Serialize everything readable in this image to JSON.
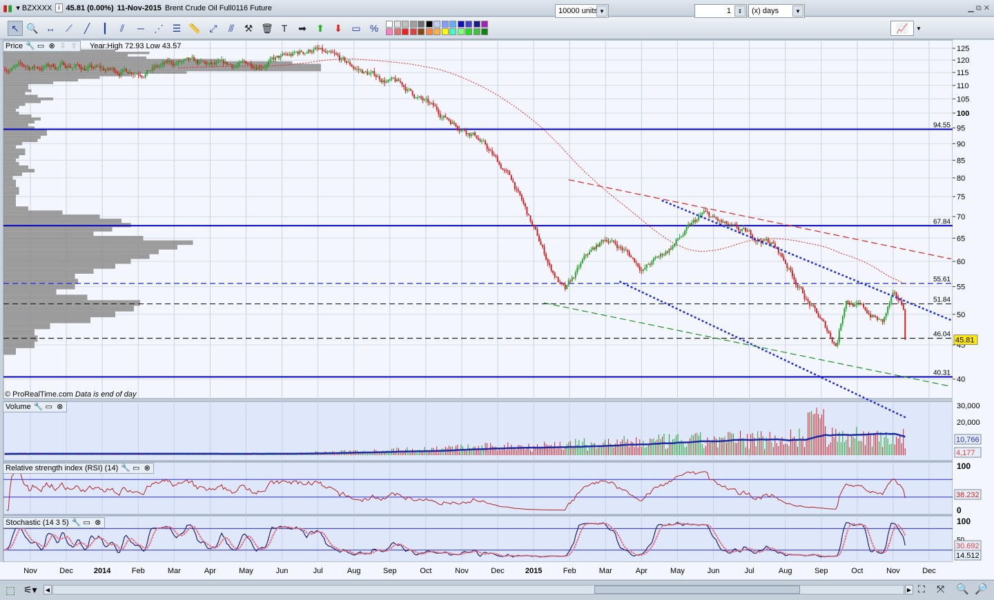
{
  "title": {
    "symbol": "BZXXXX",
    "price": "45.81 (0.00%)",
    "date": "11-Nov-2015",
    "name": "Brent Crude Oil Full0116 Future"
  },
  "toolbar": {
    "units": "10000 units",
    "period_value": "1",
    "period_unit": "(x) days",
    "tools": [
      "pointer-icon",
      "zoom-icon",
      "horizontal-measure-icon",
      "segment-icon",
      "line-icon",
      "vertical-line-icon",
      "channel-icon",
      "horizontal-line-icon",
      "fan-icon",
      "fibonacci-icon",
      "ruler-icon",
      "arrows-icon",
      "parallel-icon",
      "tools-icon",
      "trash-icon",
      "text-icon",
      "arrow-right-icon",
      "arrow-up-icon",
      "arrow-down-icon",
      "rectangle-icon",
      "percent-icon"
    ],
    "colors": [
      "#ffffff",
      "#e0e0e0",
      "#c0c0c0",
      "#a0a0a0",
      "#707070",
      "#000000",
      "#c0d0ff",
      "#80a0ff",
      "#60b0ff",
      "#1010c0",
      "#4040d0",
      "#1a1a90",
      "#a020c0",
      "#ff80c0",
      "#e07070",
      "#f02020",
      "#e04040",
      "#8b4513",
      "#ff8040",
      "#ffb040",
      "#ffff00",
      "#40ffc0",
      "#80ff80",
      "#20e020",
      "#40c040",
      "#108010"
    ]
  },
  "price_panel": {
    "label": "Price",
    "info": "Year:High 72.93 Low 43.57",
    "footer_brand": "© ProRealTime.com",
    "footer_note": "Data is end of day",
    "last": "45.81"
  },
  "volume_panel": {
    "label": "Volume",
    "avg": "10,766",
    "last": "4,177"
  },
  "rsi_panel": {
    "label": "Relative strength index (RSI) (14)",
    "value": "38.232"
  },
  "stoch_panel": {
    "label": "Stochastic (14 3 5)",
    "k": "30.692",
    "d": "14.512"
  },
  "colors": {
    "up": "#22a02a",
    "down": "#d02020",
    "level": "#0000c8",
    "ma": "#e02020",
    "volume_avg": "#1a2aa8"
  },
  "chart_data": {
    "type": "candlestick",
    "scale": "log",
    "ylim": [
      36,
      130
    ],
    "yticks": [
      125,
      120,
      115,
      110,
      105,
      100,
      95,
      90,
      85,
      80,
      75,
      70,
      65,
      60,
      55,
      50,
      45,
      40
    ],
    "xticks": [
      "Nov",
      "Dec",
      "2014",
      "Feb",
      "Mar",
      "Apr",
      "May",
      "Jun",
      "Jul",
      "Aug",
      "Sep",
      "Oct",
      "Nov",
      "Dec",
      "2015",
      "Feb",
      "Mar",
      "Apr",
      "May",
      "Jun",
      "Jul",
      "Aug",
      "Sep",
      "Oct",
      "Nov",
      "Dec"
    ],
    "anchors": [
      [
        "2013-11-01",
        117
      ],
      [
        "2013-12-01",
        118
      ],
      [
        "2014-01-01",
        115.7
      ],
      [
        "2014-02-01",
        116
      ],
      [
        "2014-03-01",
        119
      ],
      [
        "2014-04-01",
        117
      ],
      [
        "2014-05-01",
        118.5
      ],
      [
        "2014-06-01",
        121.5
      ],
      [
        "2014-06-20",
        125
      ],
      [
        "2014-07-01",
        121.5
      ],
      [
        "2014-08-01",
        115
      ],
      [
        "2014-09-01",
        110
      ],
      [
        "2014-10-01",
        100
      ],
      [
        "2014-11-01",
        93
      ],
      [
        "2014-12-01",
        79
      ],
      [
        "2015-01-01",
        59
      ],
      [
        "2015-01-14",
        54
      ],
      [
        "2015-02-01",
        61
      ],
      [
        "2015-02-16",
        65
      ],
      [
        "2015-03-01",
        62.5
      ],
      [
        "2015-03-17",
        58.5
      ],
      [
        "2015-04-01",
        61
      ],
      [
        "2015-05-06",
        70.5
      ],
      [
        "2015-06-01",
        66.5
      ],
      [
        "2015-07-01",
        64
      ],
      [
        "2015-07-12",
        60
      ],
      [
        "2015-08-01",
        52
      ],
      [
        "2015-08-24",
        45
      ],
      [
        "2015-09-01",
        53
      ],
      [
        "2015-10-01",
        48.5
      ],
      [
        "2015-10-09",
        53
      ],
      [
        "2015-11-01",
        48.5
      ],
      [
        "2015-11-11",
        45.81
      ]
    ],
    "levels": [
      {
        "value": 94.55,
        "style": "solid",
        "label": "94.55"
      },
      {
        "value": 67.84,
        "style": "solid",
        "label": "67.84"
      },
      {
        "value": 55.61,
        "style": "dashed",
        "label": "55.61"
      },
      {
        "value": 51.84,
        "style": "dashed",
        "label": "51.84"
      },
      {
        "value": 46.04,
        "style": "dashed",
        "label": "46.04"
      },
      {
        "value": 40.31,
        "style": "solid",
        "label": "40.31"
      }
    ],
    "trendlines": [
      {
        "color": "#e02020",
        "style": "dashed",
        "from": [
          "2015-01-31",
          79.5
        ],
        "to": [
          "2015-12-20",
          60.5
        ]
      },
      {
        "color": "#1a2ae0",
        "style": "dotted",
        "from": [
          "2015-04-18",
          74
        ],
        "to": [
          "2015-12-20",
          49
        ]
      },
      {
        "color": "#1a2ae0",
        "style": "dotted",
        "from": [
          "2015-03-13",
          56
        ],
        "to": [
          "2015-11-12",
          35
        ]
      },
      {
        "color": "#209020",
        "style": "dashed",
        "from": [
          "2015-01-10",
          52
        ],
        "to": [
          "2015-12-20",
          39
        ]
      }
    ],
    "volume": {
      "ylim": [
        0,
        30000
      ],
      "yticks": [
        "30,000",
        "20,000"
      ]
    },
    "rsi": {
      "ylim": [
        0,
        100
      ],
      "levels": [
        70,
        30
      ],
      "yticks": [
        "100",
        "50",
        "0"
      ]
    },
    "stochastic": {
      "ylim": [
        0,
        100
      ],
      "levels": [
        80,
        20
      ],
      "yticks": [
        "100",
        "50"
      ]
    }
  }
}
